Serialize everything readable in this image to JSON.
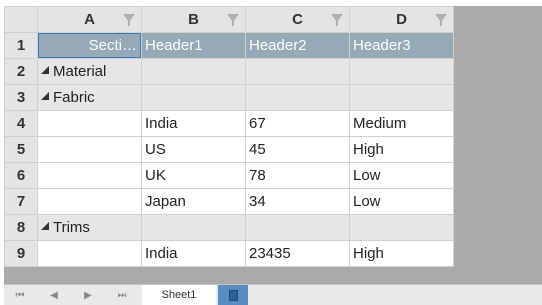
{
  "columns": [
    {
      "letter": "A",
      "icon": "filter-icon"
    },
    {
      "letter": "B",
      "icon": "filter-icon"
    },
    {
      "letter": "C",
      "icon": "filter-icon"
    },
    {
      "letter": "D",
      "icon": "filter-icon"
    }
  ],
  "rows": [
    {
      "num": "1",
      "type": "header",
      "cells": [
        "Secti…",
        "Header1",
        "Header2",
        "Header3"
      ]
    },
    {
      "num": "2",
      "type": "group",
      "level": 1,
      "cells": [
        "Material",
        "",
        "",
        ""
      ]
    },
    {
      "num": "3",
      "type": "group",
      "level": 2,
      "cells": [
        "Fabric",
        "",
        "",
        ""
      ]
    },
    {
      "num": "4",
      "type": "data",
      "cells": [
        "",
        "India",
        "67",
        "Medium"
      ]
    },
    {
      "num": "5",
      "type": "data",
      "cells": [
        "",
        "US",
        "45",
        "High"
      ]
    },
    {
      "num": "6",
      "type": "data",
      "cells": [
        "",
        "UK",
        "78",
        "Low"
      ]
    },
    {
      "num": "7",
      "type": "data",
      "cells": [
        "",
        "Japan",
        "34",
        "Low"
      ]
    },
    {
      "num": "8",
      "type": "group",
      "level": 2,
      "cells": [
        "Trims",
        "",
        "",
        ""
      ]
    },
    {
      "num": "9",
      "type": "data",
      "cells": [
        "",
        "India",
        "23435",
        "High"
      ]
    }
  ],
  "tabs": {
    "nav_icons": [
      "first-sheet-icon",
      "prev-sheet-icon",
      "next-sheet-icon",
      "last-sheet-icon"
    ],
    "nav_glyphs": [
      "⏮",
      "◀",
      "▶",
      "⏭"
    ],
    "sheets": [
      "Sheet1"
    ],
    "add_icon": "add-sheet-icon"
  },
  "colors": {
    "header_row_bg": "#95a9b7",
    "group_row_bg": "#e6e6e6",
    "selection_border": "#3b78b9",
    "add_sheet_bg": "#5a8cc4",
    "workbook_bg": "#aaaaaa"
  }
}
